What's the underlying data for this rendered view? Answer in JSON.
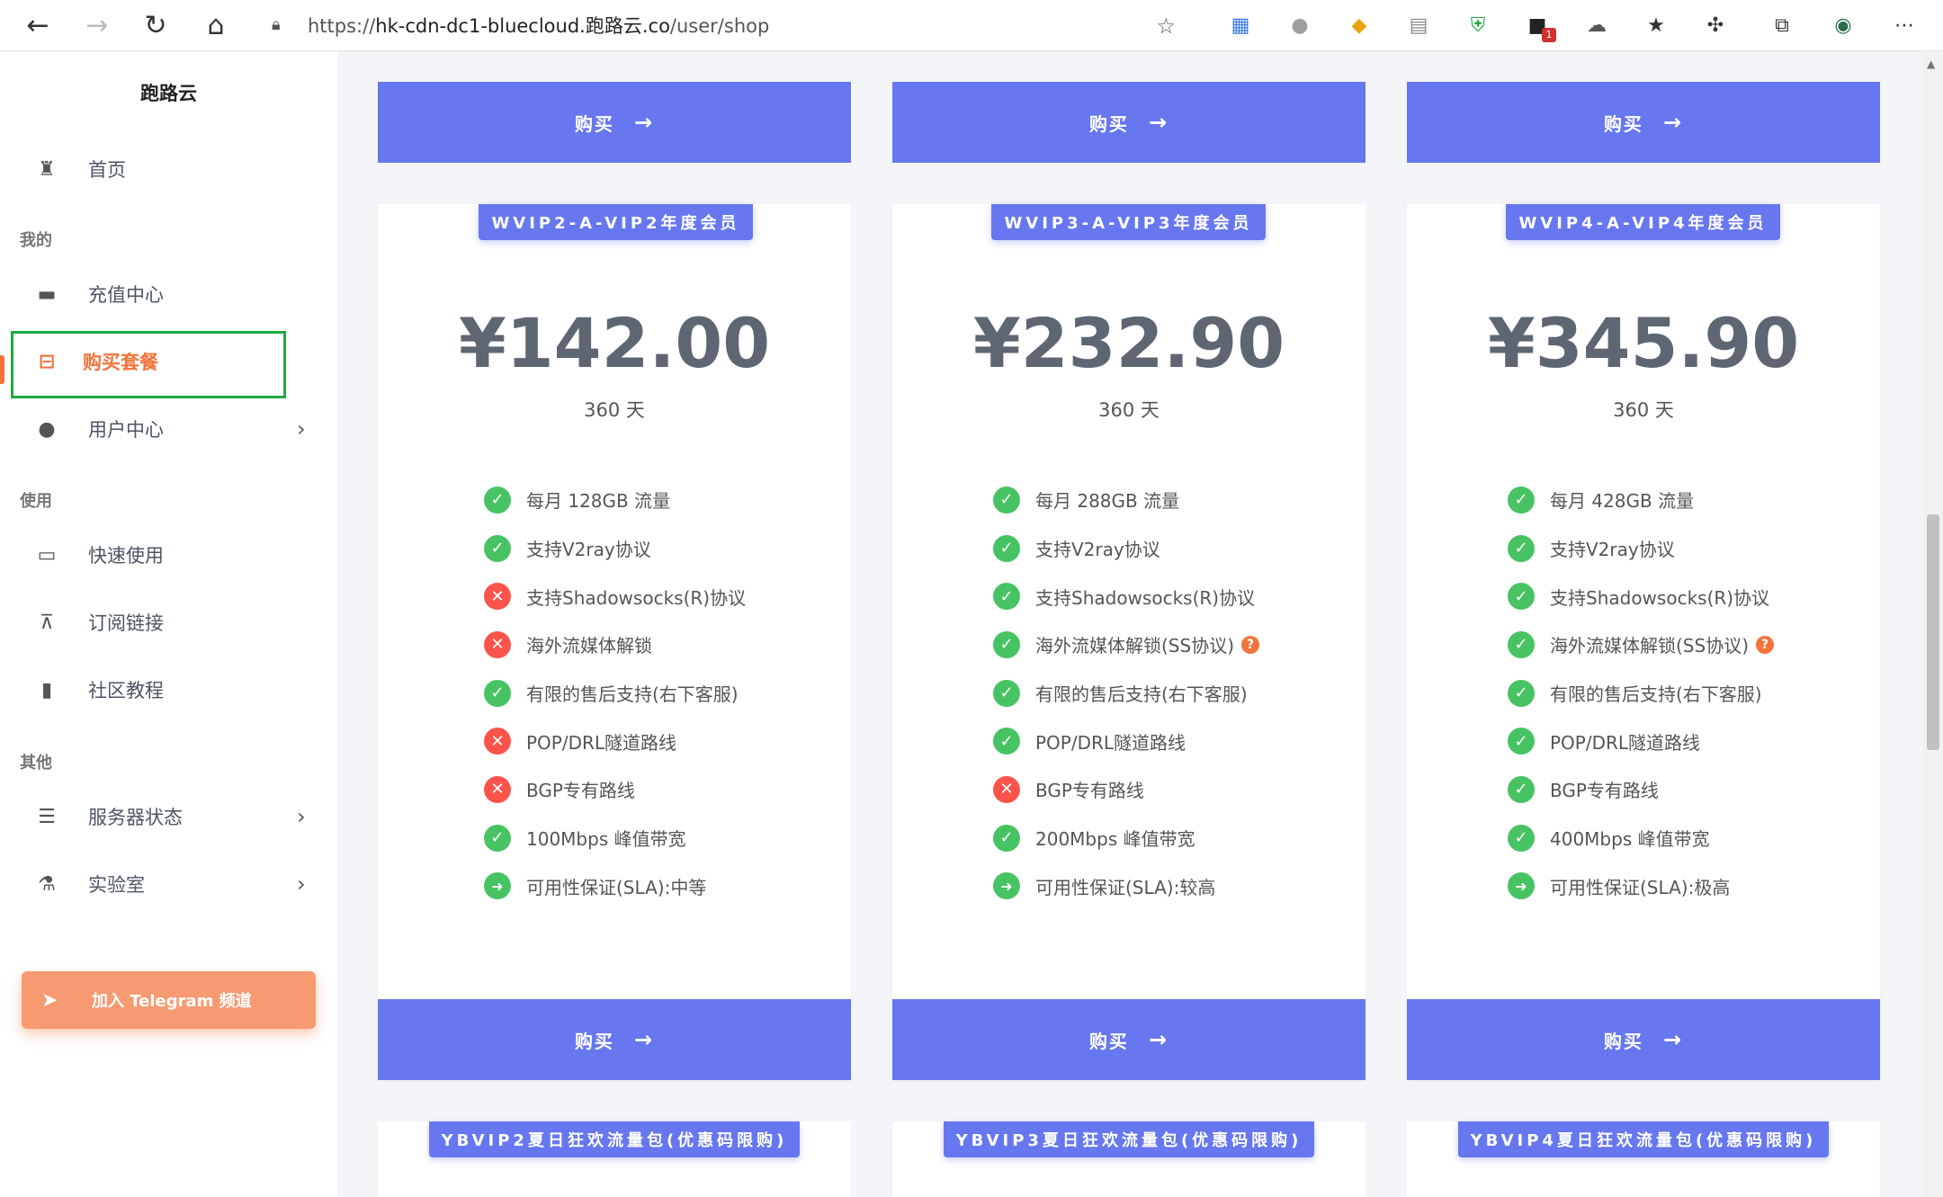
{
  "browser": {
    "url_prefix": "https://",
    "url_host": "hk-cdn-dc1-bluecloud.跑路云.co",
    "url_path": "/user/shop"
  },
  "sidebar": {
    "brand": "跑路云",
    "home_label": "首页",
    "section_mine": "我的",
    "section_use": "使用",
    "section_other": "其他",
    "items": {
      "recharge": "充值中心",
      "shop": "购买套餐",
      "user_center": "用户中心",
      "quick_use": "快速使用",
      "subscribe": "订阅链接",
      "tutorial": "社区教程",
      "server_status": "服务器状态",
      "lab": "实验室"
    },
    "telegram_label": "加入 Telegram 频道"
  },
  "buy_label": "购买",
  "plans": [
    {
      "badge": "WVIP2-A-VIP2年度会员",
      "price": "¥142.00",
      "period": "360 天",
      "features": [
        {
          "text": "每月 128GB 流量",
          "status": "yes"
        },
        {
          "text": "支持V2ray协议",
          "status": "yes"
        },
        {
          "text": "支持Shadowsocks(R)协议",
          "status": "no"
        },
        {
          "text": "海外流媒体解锁",
          "status": "no"
        },
        {
          "text": "有限的售后支持(右下客服)",
          "status": "yes"
        },
        {
          "text": "POP/DRL隧道路线",
          "status": "no"
        },
        {
          "text": "BGP专有路线",
          "status": "no"
        },
        {
          "text": "100Mbps 峰值带宽",
          "status": "yes"
        },
        {
          "text": "可用性保证(SLA):中等",
          "status": "mid"
        }
      ]
    },
    {
      "badge": "WVIP3-A-VIP3年度会员",
      "price": "¥232.90",
      "period": "360 天",
      "features": [
        {
          "text": "每月 288GB 流量",
          "status": "yes"
        },
        {
          "text": "支持V2ray协议",
          "status": "yes"
        },
        {
          "text": "支持Shadowsocks(R)协议",
          "status": "yes"
        },
        {
          "text": "海外流媒体解锁(SS协议)",
          "status": "yes",
          "help": "?"
        },
        {
          "text": "有限的售后支持(右下客服)",
          "status": "yes"
        },
        {
          "text": "POP/DRL隧道路线",
          "status": "yes"
        },
        {
          "text": "BGP专有路线",
          "status": "no"
        },
        {
          "text": "200Mbps 峰值带宽",
          "status": "yes"
        },
        {
          "text": "可用性保证(SLA):较高",
          "status": "mid"
        }
      ]
    },
    {
      "badge": "WVIP4-A-VIP4年度会员",
      "price": "¥345.90",
      "period": "360 天",
      "features": [
        {
          "text": "每月 428GB 流量",
          "status": "yes"
        },
        {
          "text": "支持V2ray协议",
          "status": "yes"
        },
        {
          "text": "支持Shadowsocks(R)协议",
          "status": "yes"
        },
        {
          "text": "海外流媒体解锁(SS协议)",
          "status": "yes",
          "help": "?"
        },
        {
          "text": "有限的售后支持(右下客服)",
          "status": "yes"
        },
        {
          "text": "POP/DRL隧道路线",
          "status": "yes"
        },
        {
          "text": "BGP专有路线",
          "status": "yes"
        },
        {
          "text": "400Mbps 峰值带宽",
          "status": "yes"
        },
        {
          "text": "可用性保证(SLA):极高",
          "status": "mid"
        }
      ]
    }
  ],
  "next_badges": [
    "YBVIP2夏日狂欢流量包(优惠码限购)",
    "YBVIP3夏日狂欢流量包(优惠码限购)",
    "YBVIP4夏日狂欢流量包(优惠码限购)"
  ],
  "icons": {
    "feature_yes": "check-circle-icon",
    "feature_no": "x-circle-icon",
    "feature_mid": "arrow-circle-icon"
  },
  "colors": {
    "primary": "#6777ef",
    "active": "#f2743b",
    "success": "#47c363",
    "danger": "#fc544b"
  }
}
